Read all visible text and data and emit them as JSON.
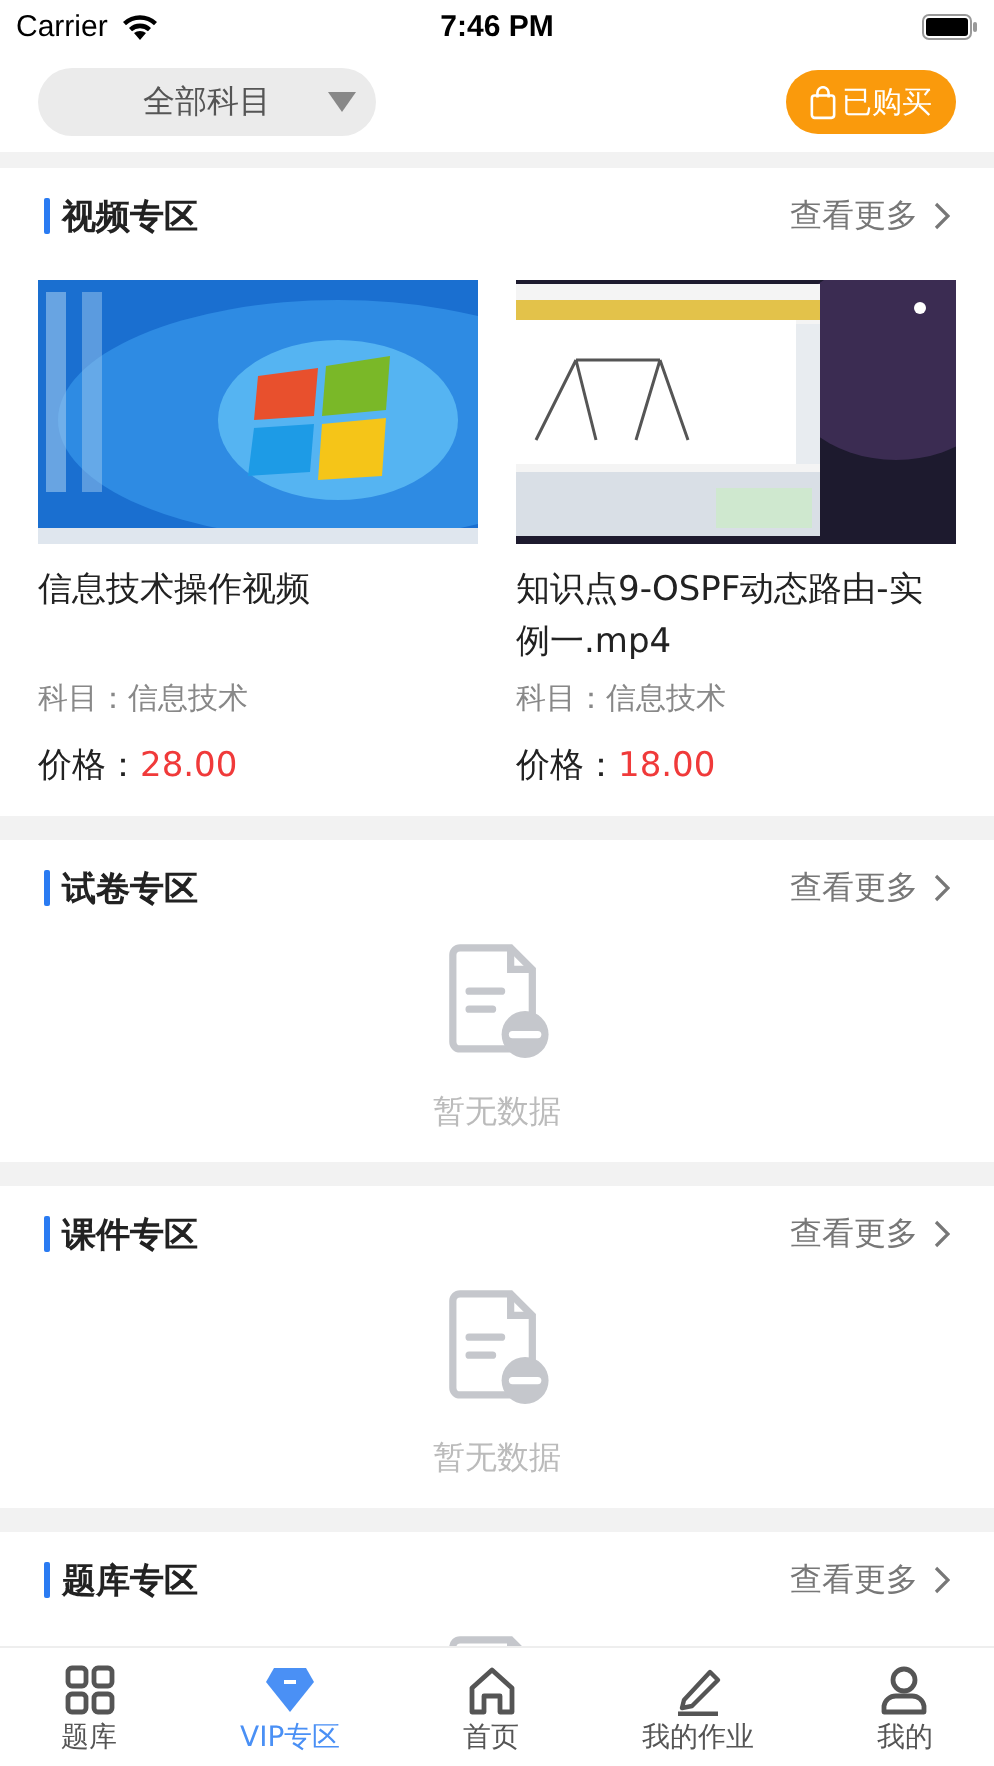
{
  "status_bar": {
    "carrier": "Carrier",
    "time": "7:46 PM"
  },
  "header": {
    "subject_filter": "全部科目",
    "purchased_button": "已购买"
  },
  "sections": [
    {
      "kind": "videos",
      "title": "视频专区",
      "more": "查看更多",
      "items": [
        {
          "title": "信息技术操作视频",
          "subject": "科目：信息技术",
          "price_label": "价格：",
          "price": "28.00"
        },
        {
          "title": "知识点9-OSPF动态路由-实例一.mp4",
          "subject": "科目：信息技术",
          "price_label": "价格：",
          "price": "18.00"
        }
      ]
    },
    {
      "kind": "empty",
      "title": "试卷专区",
      "more": "查看更多",
      "empty_text": "暂无数据"
    },
    {
      "kind": "empty",
      "title": "课件专区",
      "more": "查看更多",
      "empty_text": "暂无数据"
    },
    {
      "kind": "empty",
      "title": "题库专区",
      "more": "查看更多"
    }
  ],
  "tab_bar": [
    {
      "label": "题库",
      "selected": false
    },
    {
      "label": "VIP专区",
      "selected": true
    },
    {
      "label": "首页",
      "selected": false
    },
    {
      "label": "我的作业",
      "selected": false
    },
    {
      "label": "我的",
      "selected": false
    }
  ]
}
